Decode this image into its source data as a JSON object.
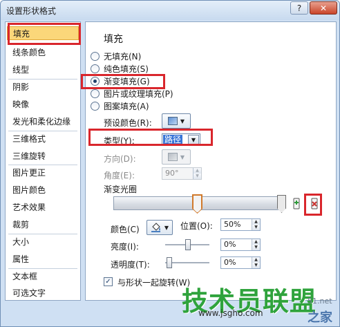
{
  "window": {
    "title": "设置形状格式",
    "help_label": "?",
    "close_label": "✕"
  },
  "sidebar": {
    "items": [
      {
        "label": "填充"
      },
      {
        "label": "线条颜色"
      },
      {
        "label": "线型"
      },
      {
        "label": "阴影"
      },
      {
        "label": "映像"
      },
      {
        "label": "发光和柔化边缘"
      },
      {
        "label": "三维格式"
      },
      {
        "label": "三维旋转"
      },
      {
        "label": "图片更正"
      },
      {
        "label": "图片颜色"
      },
      {
        "label": "艺术效果"
      },
      {
        "label": "裁剪"
      },
      {
        "label": "大小"
      },
      {
        "label": "属性"
      },
      {
        "label": "文本框"
      },
      {
        "label": "可选文字"
      }
    ],
    "selected": "填充"
  },
  "fill": {
    "section_title": "填充",
    "options": [
      {
        "label": "无填充(N)",
        "checked": false
      },
      {
        "label": "纯色填充(S)",
        "checked": false
      },
      {
        "label": "渐变填充(G)",
        "checked": true
      },
      {
        "label": "图片或纹理填充(P)",
        "checked": false
      },
      {
        "label": "图案填充(A)",
        "checked": false
      }
    ],
    "preset_label": "预设颜色(R):",
    "type_label": "类型(Y):",
    "type_value": "路径",
    "direction_label": "方向(D):",
    "angle_label": "角度(E):",
    "angle_value": "90°",
    "gradient_stops_label": "渐变光圈",
    "color_label": "颜色(C)",
    "position_label": "位置(O):",
    "position_value": "50%",
    "brightness_label": "亮度(I):",
    "brightness_value": "0%",
    "transparency_label": "透明度(T):",
    "transparency_value": "0%",
    "rotate_label": "与形状一起旋转(W)",
    "rotate_checked": true,
    "check_mark": "✓"
  },
  "icons": {
    "dropdown_arrow": "▼",
    "spin_up": "▲",
    "spin_down": "▼"
  },
  "watermark": {
    "brand": "技术员联盟",
    "url": "www.jsgho.com",
    "corner_top": "51.net",
    "corner": "之家"
  },
  "colors": {
    "highlight": "#d9262c",
    "selection": "#fbd77a",
    "accent": "#3875d7"
  }
}
